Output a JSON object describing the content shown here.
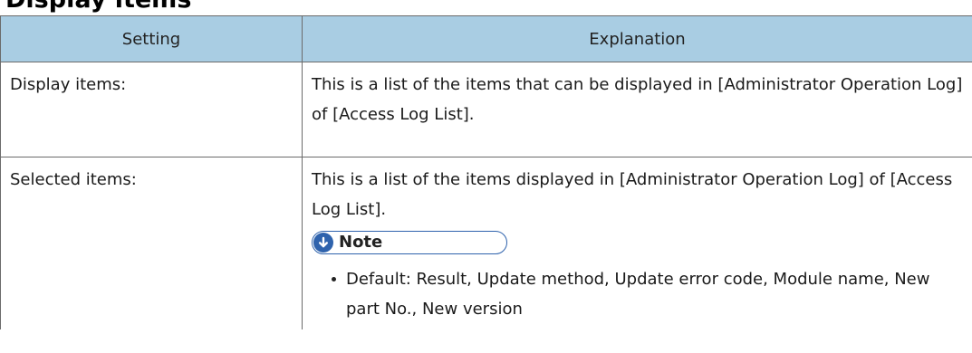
{
  "section": {
    "heading": "Display items"
  },
  "table": {
    "columns": [
      "Setting",
      "Explanation"
    ],
    "rows": [
      {
        "setting": "Display items:",
        "explanation": "This is a list of the items that can be displayed in [Administrator Operation Log] of [Access Log List]."
      },
      {
        "setting": "Selected items:",
        "explanation": "This is a list of the items displayed in [Administrator Operation Log] of [Access Log List].",
        "note": {
          "label": "Note",
          "icon": "down-arrow-circle-icon",
          "items": [
            "Default: Result, Update method, Update error code, Module name, New part No., New version"
          ]
        }
      }
    ]
  },
  "colors": {
    "header_bg": "#a9cde3",
    "border": "#6b6b6b",
    "note_accent": "#2f63ad"
  }
}
